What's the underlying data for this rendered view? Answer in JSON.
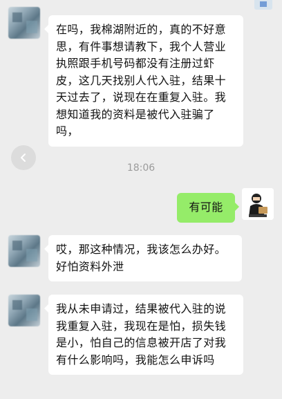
{
  "timestamp": "18:06",
  "messages": [
    {
      "side": "left",
      "text": "在吗，我棉湖附近的，真的不好意思，有件事想请教下，我个人营业执照跟手机号码都没有注册过虾皮，这几天找别人代入驻，结果十天过去了，说现在在重复入驻。我想知道我的资料是被代入驻骗了吗，"
    },
    {
      "side": "right",
      "text": "有可能"
    },
    {
      "side": "left",
      "text": "哎，那这种情况，我该怎么办好。好怕资料外泄"
    },
    {
      "side": "left",
      "text": "我从未申请过，结果被代入驻的说我重复入驻，我现在是怕，损失钱是小，怕自己的信息被开店了对我有什么影响吗，我能怎么申诉吗"
    }
  ]
}
